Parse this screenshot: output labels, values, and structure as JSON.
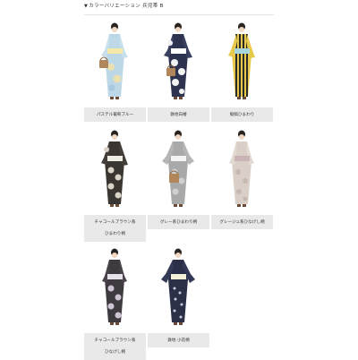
{
  "section": {
    "title_marker": "▼",
    "title": "カラーバリエーション 兵児帯 B"
  },
  "items": [
    {
      "label": "パステル葡萄ブルー",
      "label2": ""
    },
    {
      "label": "鉄地白椿",
      "label2": ""
    },
    {
      "label": "縦縞ひまわり",
      "label2": ""
    },
    {
      "label": "チャコールブラウン系",
      "label2": "ひまわり柄"
    },
    {
      "label": "グレー系ひまわり柄",
      "label2": ""
    },
    {
      "label": "グレージュ系ひなげし柄",
      "label2": ""
    },
    {
      "label": "チャコールブラウン系",
      "label2": "ひなげし柄"
    },
    {
      "label": "鉄地 小花柄",
      "label2": ""
    }
  ],
  "colors": {
    "card_bg": "#e9e9e9",
    "photo_bg": "#ffffff",
    "pastel_blue": "#bcd7e6",
    "indigo": "#2e3450",
    "yellow_stripe": "#e8c84a",
    "charcoal": "#3a3632",
    "grey": "#a9a9a9",
    "greige": "#d9cfc6"
  },
  "icons": [
    "kimono-figure",
    "basket-bag"
  ]
}
